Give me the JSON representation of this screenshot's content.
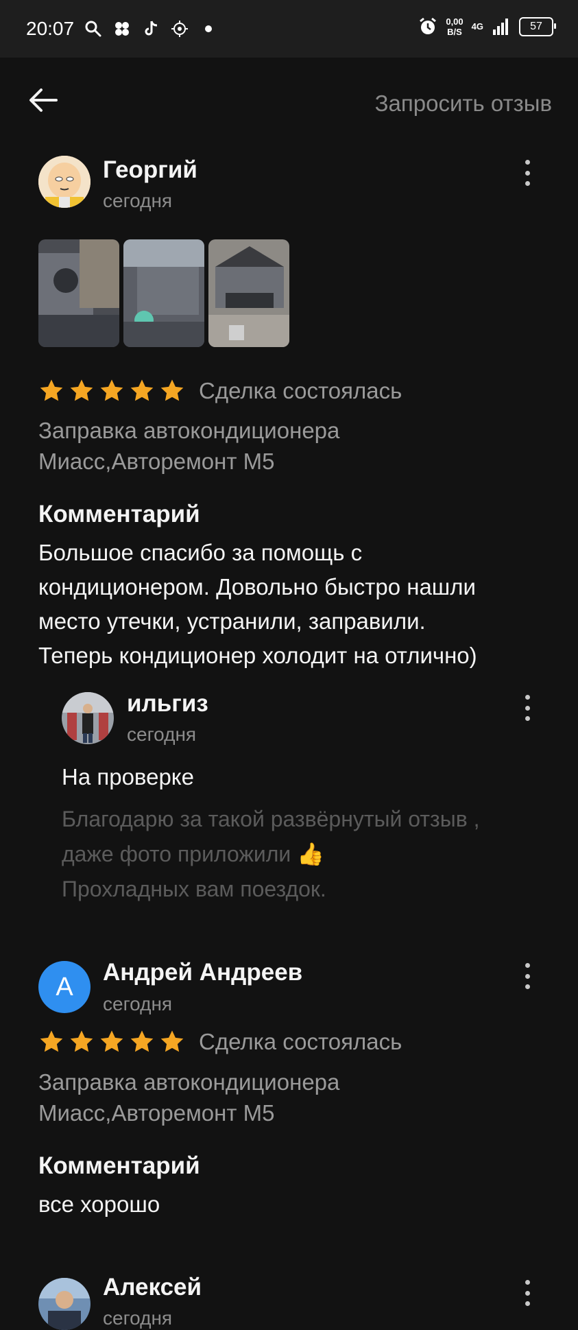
{
  "status_bar": {
    "time": "20:07",
    "net_speed_value": "0,00",
    "net_speed_unit": "B/S",
    "network": "4G",
    "battery": "57",
    "icons": [
      "search-icon",
      "apps-icon",
      "tiktok-icon",
      "settings-chip-icon",
      "dot-icon",
      "alarm-icon",
      "signal-icon",
      "battery-icon"
    ]
  },
  "header": {
    "back_icon": "arrow-left-icon",
    "request_review_label": "Запросить отзыв"
  },
  "reviews": [
    {
      "author": "Георгий",
      "date": "сегодня",
      "rating": 5,
      "deal_status": "Сделка состоялась",
      "service_line1": "Заправка автокондиционера",
      "service_line2": "Миасс,Авторемонт М5",
      "comment_title": "Комментарий",
      "comment_lines": [
        "Большое спасибо за помощь с",
        "кондиционером. Довольно быстро нашли",
        "место утечки, устранили, заправили.",
        "Теперь кондиционер холодит на отлично)"
      ],
      "reply": {
        "author": "ильгиз",
        "date": "сегодня",
        "status": "На проверке",
        "lines": [
          "Благодарю за такой развёрнутый отзыв ,",
          "даже фото приложили 👍",
          "Прохладных вам поездок."
        ]
      }
    },
    {
      "author": "Андрей Андреев",
      "avatar_letter": "А",
      "avatar_color": "#2f8ff0",
      "date": "сегодня",
      "rating": 5,
      "deal_status": "Сделка состоялась",
      "service_line1": "Заправка автокондиционера",
      "service_line2": "Миасс,Авторемонт М5",
      "comment_title": "Комментарий",
      "comment_text": "все хорошо"
    },
    {
      "author": "Алексей",
      "date": "сегодня"
    }
  ],
  "colors": {
    "background": "#121212",
    "status_bar": "#1e1e1e",
    "star": "#f5a623",
    "muted_text": "#9a9a9a",
    "reply_text": "#5b5b5b"
  }
}
